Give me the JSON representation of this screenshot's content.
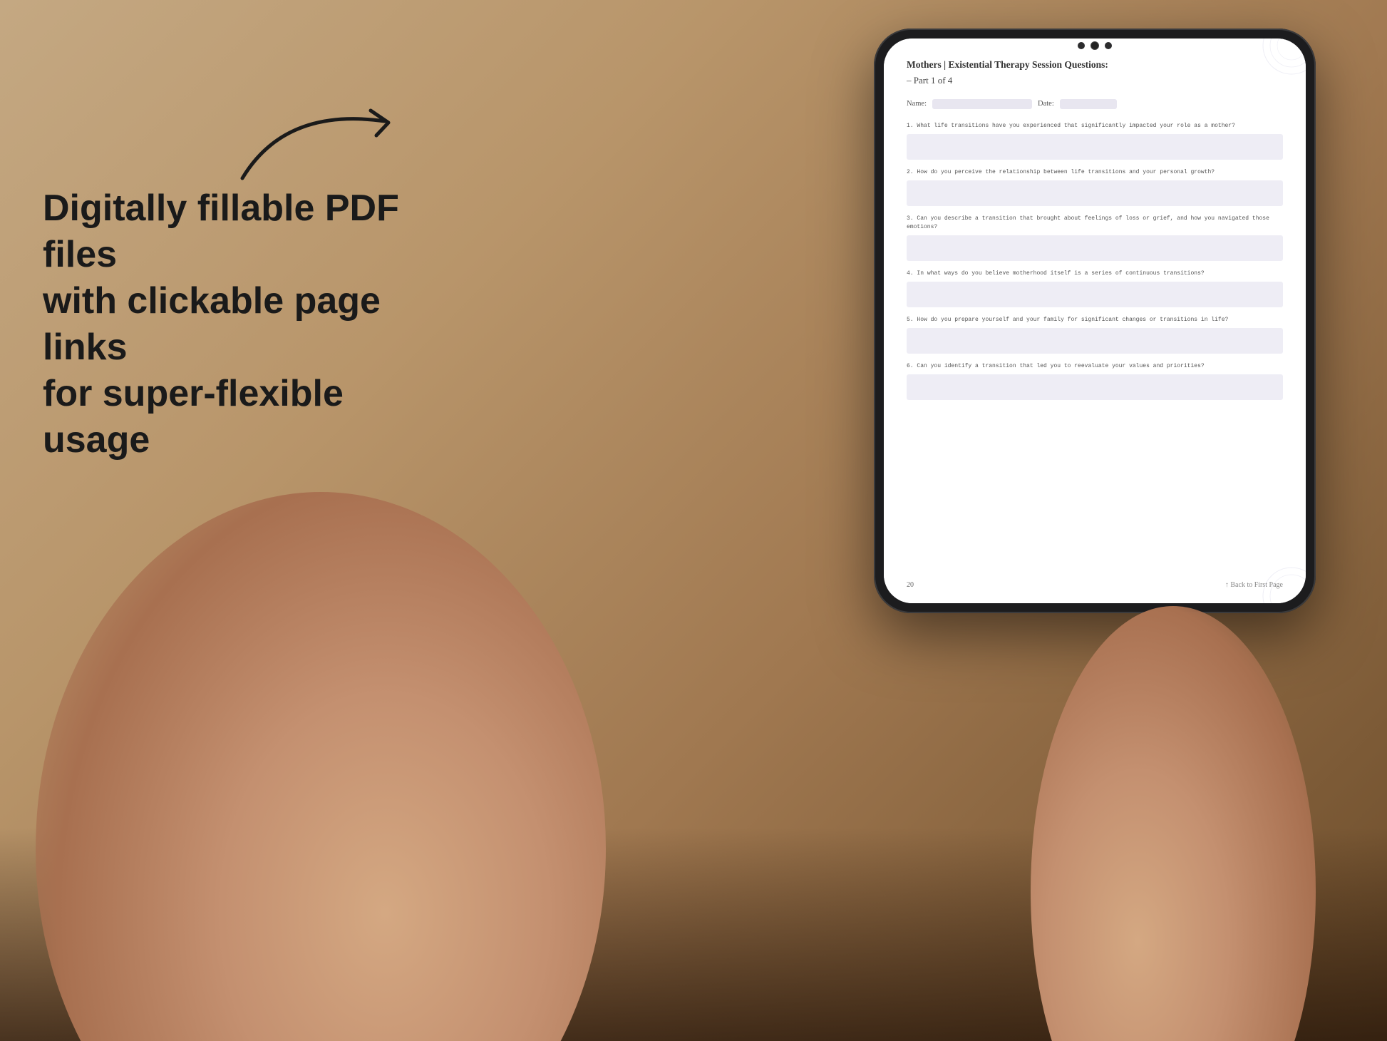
{
  "background": {
    "color_start": "#c4a882",
    "color_end": "#6b4c2a"
  },
  "left_text": {
    "line1": "Digitally fillable PDF files",
    "line2": "with clickable page links",
    "line3": "for super-flexible usage"
  },
  "pdf": {
    "title": "Mothers | Existential Therapy Session Questions:",
    "subtitle": "– Part 1 of 4",
    "name_label": "Name:",
    "date_label": "Date:",
    "questions": [
      {
        "number": "1.",
        "text": "What life transitions have you experienced that significantly impacted your role as a mother?"
      },
      {
        "number": "2.",
        "text": "How do you perceive the relationship between life transitions and your personal growth?"
      },
      {
        "number": "3.",
        "text": "Can you describe a transition that brought about feelings of loss or grief, and how you navigated those emotions?"
      },
      {
        "number": "4.",
        "text": "In what ways do you believe motherhood itself is a series of continuous transitions?"
      },
      {
        "number": "5.",
        "text": "How do you prepare yourself and your family for significant changes or transitions in life?"
      },
      {
        "number": "6.",
        "text": "Can you identify a transition that led you to reevaluate your values and priorities?"
      }
    ],
    "page_number": "20",
    "back_link": "↑ Back to First Page"
  }
}
